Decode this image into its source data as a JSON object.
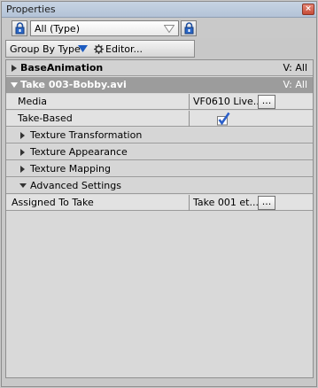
{
  "window": {
    "title": "Properties",
    "close_label": "×"
  },
  "toolbar": {
    "type_filter": "All (Type)",
    "group_by_label": "Group By Type",
    "editor_label": "Editor..."
  },
  "sections": {
    "base_animation": {
      "label": "BaseAnimation",
      "visibility": "V: All"
    },
    "take": {
      "label": "Take 003-Bobby.avi",
      "visibility": "V: All"
    }
  },
  "properties": {
    "media": {
      "label": "Media",
      "value": "VF0610 Live..."
    },
    "take_based": {
      "label": "Take-Based",
      "checked": true
    },
    "assigned_to_take": {
      "label": "Assigned To Take",
      "value": "Take 001 et..."
    }
  },
  "subgroups": {
    "texture_transformation": "Texture Transformation",
    "texture_appearance": "Texture Appearance",
    "texture_mapping": "Texture Mapping",
    "advanced_settings": "Advanced Settings"
  },
  "ellipsis_label": "...",
  "colors": {
    "titlebar": "#c1cfe0",
    "selected_section": "#9c9c9c",
    "check": "#2b5fc9"
  }
}
